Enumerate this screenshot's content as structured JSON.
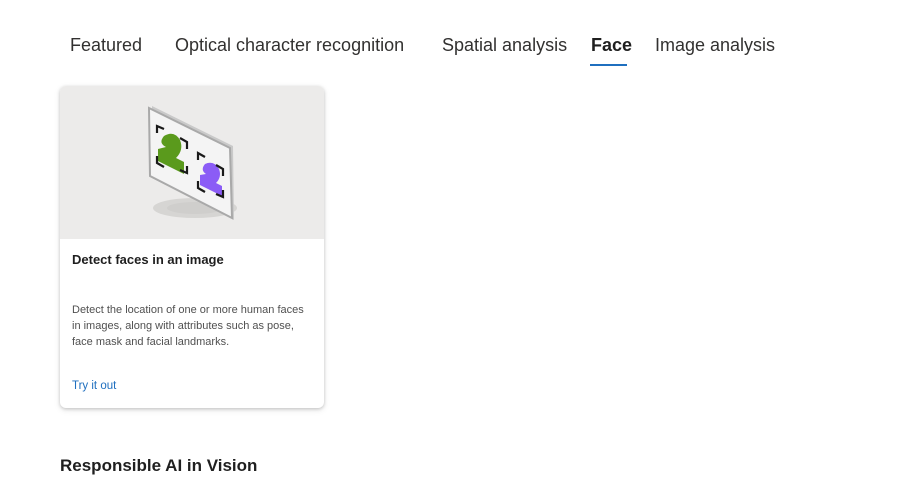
{
  "tabs": [
    {
      "label": "Featured"
    },
    {
      "label": "Optical character recognition"
    },
    {
      "label": "Spatial analysis"
    },
    {
      "label": "Face",
      "active": true
    },
    {
      "label": "Image analysis"
    }
  ],
  "card": {
    "illustration": "face-detection-illustration",
    "title": "Detect faces in an image",
    "description": "Detect the location of one or more human faces in images, along with attributes such as pose, face mask and facial landmarks.",
    "link_label": "Try it out"
  },
  "section": {
    "heading": "Responsible AI in Vision"
  },
  "colors": {
    "accent": "#1f6fbf",
    "card_media_bg": "#ecebea",
    "face_green": "#5a9a1c",
    "face_purple": "#8b5cf6"
  }
}
